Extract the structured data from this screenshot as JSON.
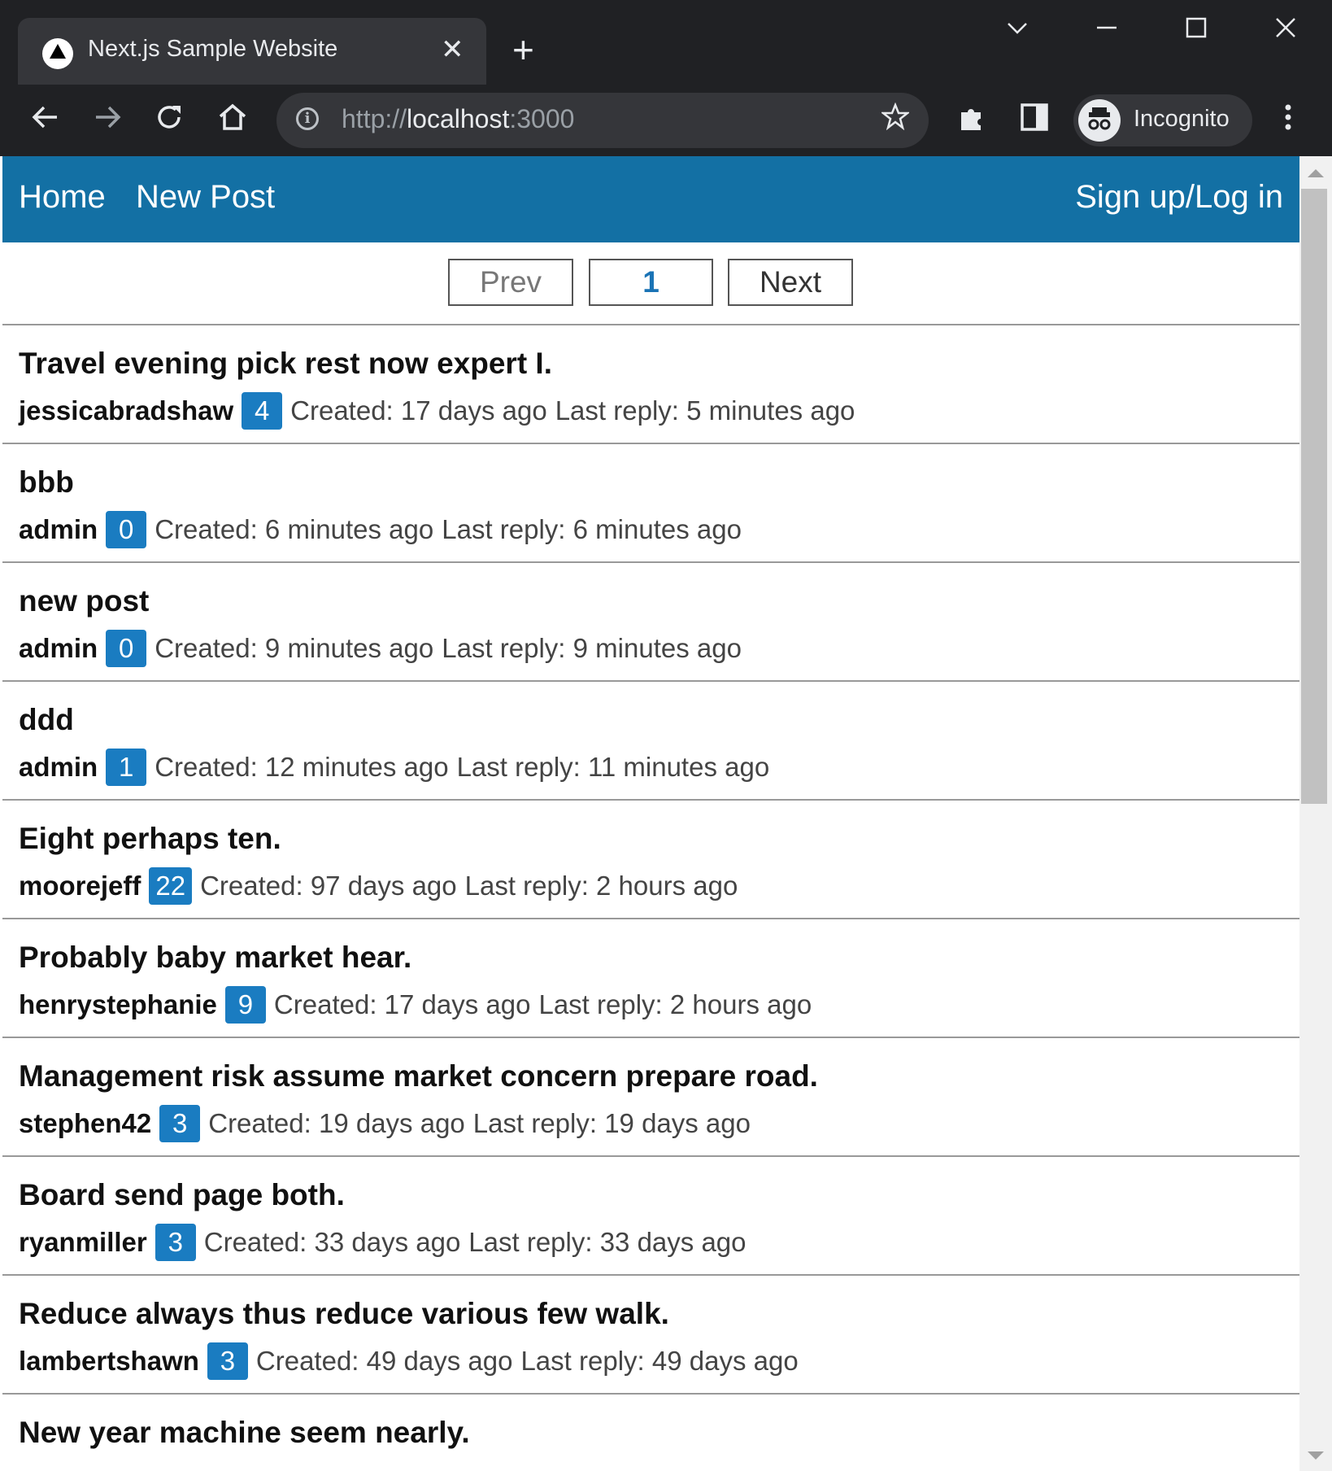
{
  "browser": {
    "tab_title": "Next.js Sample Website",
    "tab_close": "✕",
    "new_tab": "+",
    "url_scheme": "http://",
    "url_host": "localhost",
    "url_port": ":3000",
    "profile_label": "Incognito",
    "icons": [
      "back-icon",
      "forward-icon",
      "reload-icon",
      "home-icon",
      "info-icon",
      "star-icon",
      "extensions-icon",
      "side-panel-icon",
      "incognito-icon",
      "menu-icon",
      "minimize-icon",
      "maximize-icon",
      "close-icon",
      "tab-search-icon"
    ]
  },
  "nav": {
    "home": "Home",
    "new_post": "New Post",
    "auth": "Sign up/Log in"
  },
  "pagination": {
    "prev": "Prev",
    "current": "1",
    "next": "Next"
  },
  "posts": [
    {
      "title": "Travel evening pick rest now expert I.",
      "author": "jessicabradshaw",
      "count": "4",
      "created": "Created: 17 days ago",
      "last_reply": "Last reply: 5 minutes ago"
    },
    {
      "title": "bbb",
      "author": "admin",
      "count": "0",
      "created": "Created: 6 minutes ago",
      "last_reply": "Last reply: 6 minutes ago"
    },
    {
      "title": "new post",
      "author": "admin",
      "count": "0",
      "created": "Created: 9 minutes ago",
      "last_reply": "Last reply: 9 minutes ago"
    },
    {
      "title": "ddd",
      "author": "admin",
      "count": "1",
      "created": "Created: 12 minutes ago",
      "last_reply": "Last reply: 11 minutes ago"
    },
    {
      "title": "Eight perhaps ten.",
      "author": "moorejeff",
      "count": "22",
      "created": "Created: 97 days ago",
      "last_reply": "Last reply: 2 hours ago"
    },
    {
      "title": "Probably baby market hear.",
      "author": "henrystephanie",
      "count": "9",
      "created": "Created: 17 days ago",
      "last_reply": "Last reply: 2 hours ago"
    },
    {
      "title": "Management risk assume market concern prepare road.",
      "author": "stephen42",
      "count": "3",
      "created": "Created: 19 days ago",
      "last_reply": "Last reply: 19 days ago"
    },
    {
      "title": "Board send page both.",
      "author": "ryanmiller",
      "count": "3",
      "created": "Created: 33 days ago",
      "last_reply": "Last reply: 33 days ago"
    },
    {
      "title": "Reduce always thus reduce various few walk.",
      "author": "lambertshawn",
      "count": "3",
      "created": "Created: 49 days ago",
      "last_reply": "Last reply: 49 days ago"
    },
    {
      "title": "New year machine seem nearly.",
      "author": "",
      "count": "",
      "created": "",
      "last_reply": ""
    }
  ],
  "colors": {
    "navbar": "#1370a4",
    "badge": "#1a7cc1",
    "chrome": "#202124"
  }
}
